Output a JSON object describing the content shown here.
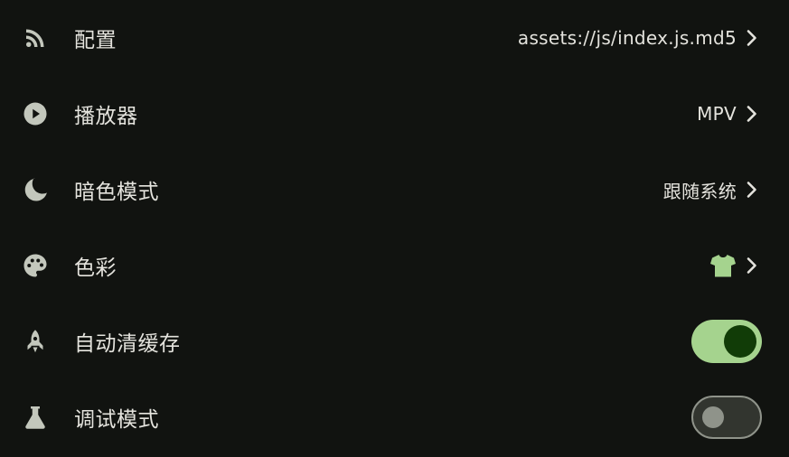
{
  "colors": {
    "background": "#111310",
    "text": "#e4e3dd",
    "icon": "#c3c7bc",
    "accent": "#a5d38e",
    "accent_dark": "#113c07",
    "toggle_off_track": "#32352f",
    "toggle_off_outline": "#8f938a"
  },
  "settings": [
    {
      "icon": "rss-feed-icon",
      "label": "配置",
      "value": "assets://js/index.js.md5",
      "control": "chevron"
    },
    {
      "icon": "play-circle-icon",
      "label": "播放器",
      "value": "MPV",
      "control": "chevron"
    },
    {
      "icon": "moon-icon",
      "label": "暗色模式",
      "value": "跟随系统",
      "control": "chevron"
    },
    {
      "icon": "palette-icon",
      "label": "色彩",
      "value_icon": "tshirt-icon",
      "control": "chevron"
    },
    {
      "icon": "rocket-icon",
      "label": "自动清缓存",
      "control": "toggle",
      "toggle_on": true
    },
    {
      "icon": "flask-icon",
      "label": "调试模式",
      "control": "toggle",
      "toggle_on": false
    }
  ]
}
